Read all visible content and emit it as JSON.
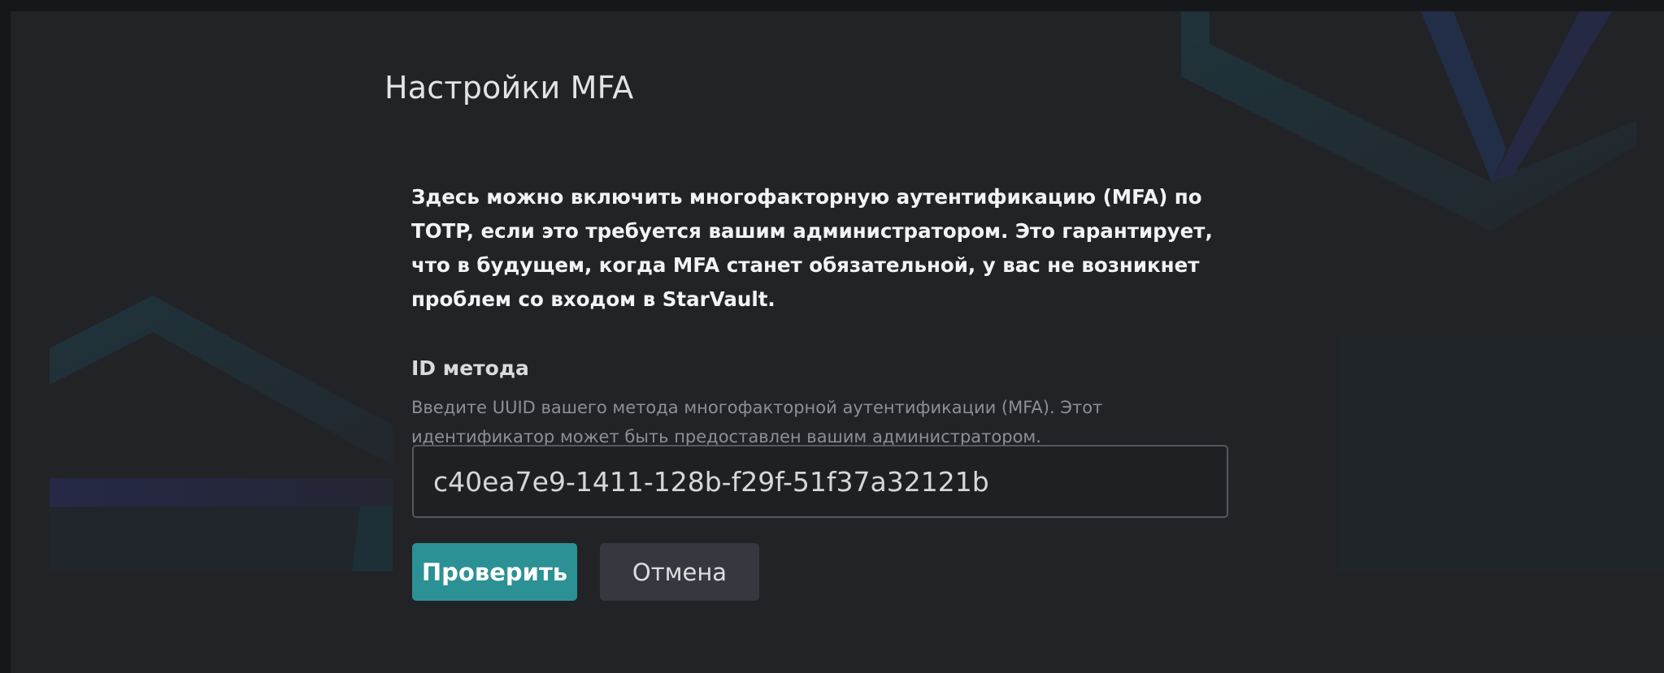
{
  "page": {
    "title": "Настройки MFA",
    "intro": "Здесь можно включить многофакторную аутентификацию (MFA) по TOTP, если это требуется вашим администратором. Это гарантирует, что в будущем, когда MFA станет обязательной, у вас не возникнет проблем со входом в StarVault."
  },
  "method_field": {
    "label": "ID метода",
    "help": "Введите UUID вашего метода многофакторной аутентификации (MFA). Этот идентификатор может быть предоставлен вашим администратором.",
    "value": "c40ea7e9-1411-128b-f29f-51f37a32121b"
  },
  "actions": {
    "verify_label": "Проверить",
    "cancel_label": "Отмена"
  },
  "colors": {
    "background": "#222327",
    "accent": "#2b9194",
    "secondary_button": "#37383f"
  }
}
